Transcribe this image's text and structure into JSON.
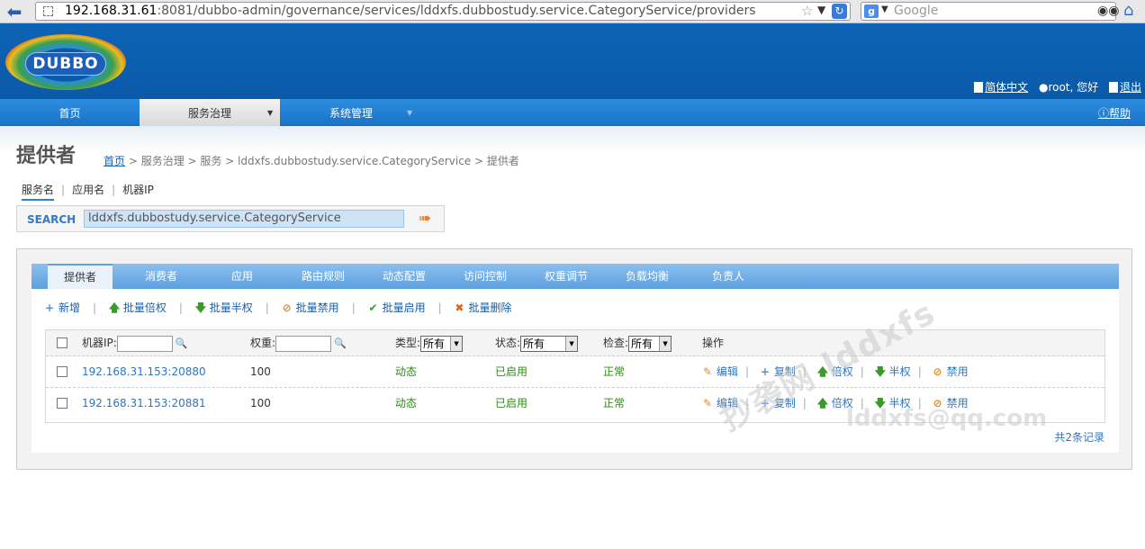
{
  "browser": {
    "url_host": "192.168.31.61",
    "url_rest": ":8081/dubbo-admin/governance/services/lddxfs.dubbostudy.service.CategoryService/providers",
    "search_placeholder": "Google"
  },
  "header": {
    "logo_text": "DUBBO",
    "lang_link": "简体中文",
    "user_greeting": "root, 您好",
    "logout": "退出"
  },
  "nav": {
    "items": [
      {
        "label": "首页"
      },
      {
        "label": "服务治理"
      },
      {
        "label": "系统管理"
      }
    ],
    "help": "帮助"
  },
  "page": {
    "title": "提供者",
    "breadcrumb_home": "首页",
    "breadcrumb_rest": " > 服务治理 > 服务 > lddxfs.dubbostudy.service.CategoryService > 提供者"
  },
  "search": {
    "tabs": [
      "服务名",
      "应用名",
      "机器IP"
    ],
    "label": "SEARCH",
    "value": "lddxfs.dubbostudy.service.CategoryService"
  },
  "tabs": [
    "提供者",
    "消费者",
    "应用",
    "路由规则",
    "动态配置",
    "访问控制",
    "权重调节",
    "负载均衡",
    "负责人"
  ],
  "toolbar": {
    "add": "新增",
    "batch_double": "批量倍权",
    "batch_half": "批量半权",
    "batch_disable": "批量禁用",
    "batch_enable": "批量启用",
    "batch_delete": "批量删除"
  },
  "table": {
    "headers": {
      "ip": "机器IP:",
      "weight": "权重:",
      "type": "类型:",
      "status": "状态:",
      "check": "检查:",
      "actions": "操作"
    },
    "filters": {
      "type": "所有",
      "status": "所有",
      "check": "所有"
    },
    "rows": [
      {
        "address": "192.168.31.153:20880",
        "weight": "100",
        "type": "动态",
        "status": "已启用",
        "check": "正常"
      },
      {
        "address": "192.168.31.153:20881",
        "weight": "100",
        "type": "动态",
        "status": "已启用",
        "check": "正常"
      }
    ],
    "row_actions": {
      "edit": "编辑",
      "copy": "复制",
      "double": "倍权",
      "half": "半权",
      "disable": "禁用"
    },
    "records": "共2条记录"
  },
  "watermark": {
    "line1": "抄袭网 lddxfs",
    "line2": "lddxfs@qq.com"
  },
  "colors": {
    "header_blue": "#0d63b5",
    "nav_blue": "#2d8de0",
    "link_blue": "#2e75c2",
    "status_green": "#2e8a14"
  }
}
